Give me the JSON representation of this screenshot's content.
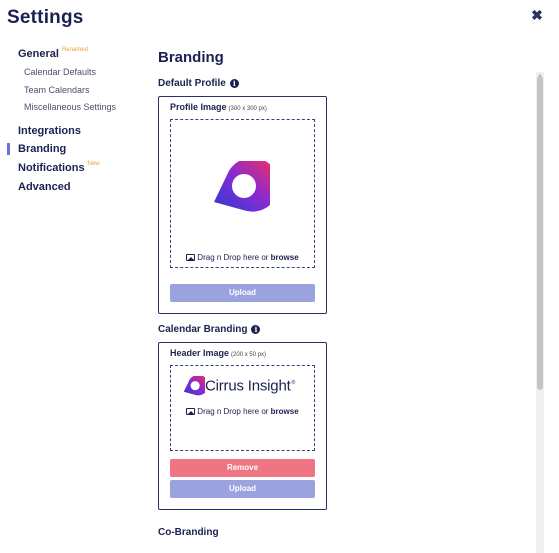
{
  "page": {
    "title": "Settings"
  },
  "nav": {
    "general": {
      "label": "General",
      "tag": "Renamed"
    },
    "general_items": [
      "Calendar Defaults",
      "Team Calendars",
      "Miscellaneous Settings"
    ],
    "integrations": "Integrations",
    "branding": "Branding",
    "notifications": {
      "label": "Notifications",
      "tag": "New"
    },
    "advanced": "Advanced",
    "active": "Branding"
  },
  "main": {
    "heading": "Branding",
    "default_profile": {
      "heading": "Default Profile",
      "card_label": "Profile Image",
      "card_dims": "(300 x 300 px)",
      "drop_text": "Drag n Drop here or ",
      "browse": "browse",
      "upload_label": "Upload"
    },
    "calendar_branding": {
      "heading": "Calendar Branding",
      "card_label": "Header Image",
      "card_dims": "(200 x 50 px)",
      "logo_text": "Cirrus Insight",
      "logo_mark": "®",
      "drop_text": "Drag n Drop here or ",
      "browse": "browse",
      "remove_label": "Remove",
      "upload_label": "Upload"
    },
    "co_branding": {
      "heading": "Co-Branding"
    }
  },
  "icons": {
    "close": "close-icon",
    "info": "info-icon",
    "image": "image-icon"
  },
  "colors": {
    "text": "#1b2150",
    "accent": "#6b74d6",
    "upload": "#9aa3dd",
    "remove": "#f07584",
    "tag": "#e8a13c"
  }
}
